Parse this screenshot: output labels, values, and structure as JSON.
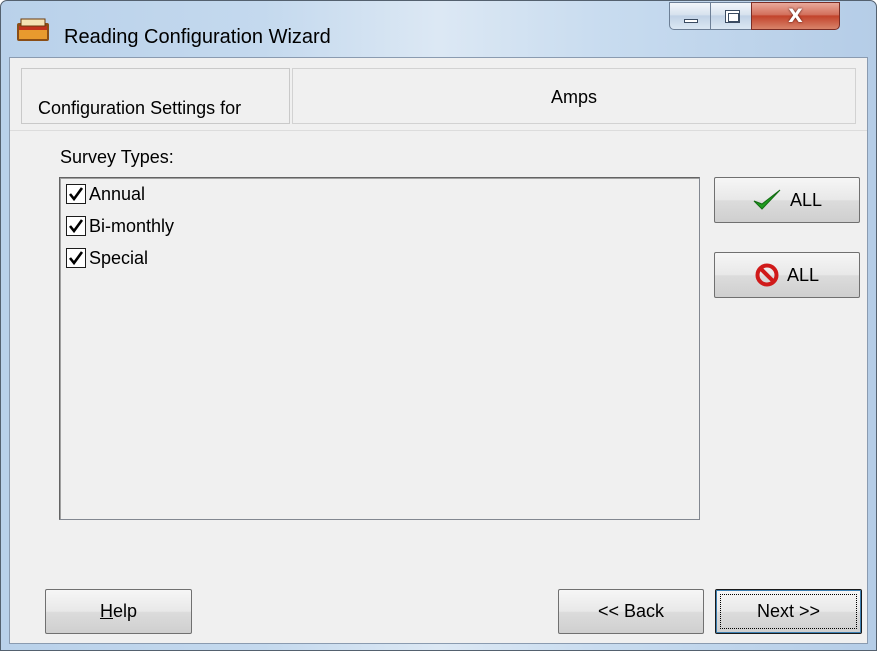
{
  "window": {
    "title": "Reading Configuration Wizard",
    "controls": {
      "minimize": "minimize",
      "maximize": "maximize",
      "close": "X"
    }
  },
  "config": {
    "label": "Configuration Settings for",
    "value": "Amps"
  },
  "survey": {
    "label": "Survey Types:",
    "items": [
      {
        "label": "Annual",
        "checked": true
      },
      {
        "label": "Bi-monthly",
        "checked": true
      },
      {
        "label": "Special",
        "checked": true
      }
    ]
  },
  "buttons": {
    "select_all": {
      "label": "ALL",
      "icon": "green-check-icon"
    },
    "clear_all": {
      "label": "ALL",
      "icon": "red-prohibited-icon"
    },
    "help": {
      "prefix": "H",
      "rest": "elp"
    },
    "back": "<< Back",
    "next": "Next >>"
  },
  "colors": {
    "check_green": "#1f9d1f",
    "prohibit_red": "#d01a1a",
    "close_red": "#c2432b"
  }
}
